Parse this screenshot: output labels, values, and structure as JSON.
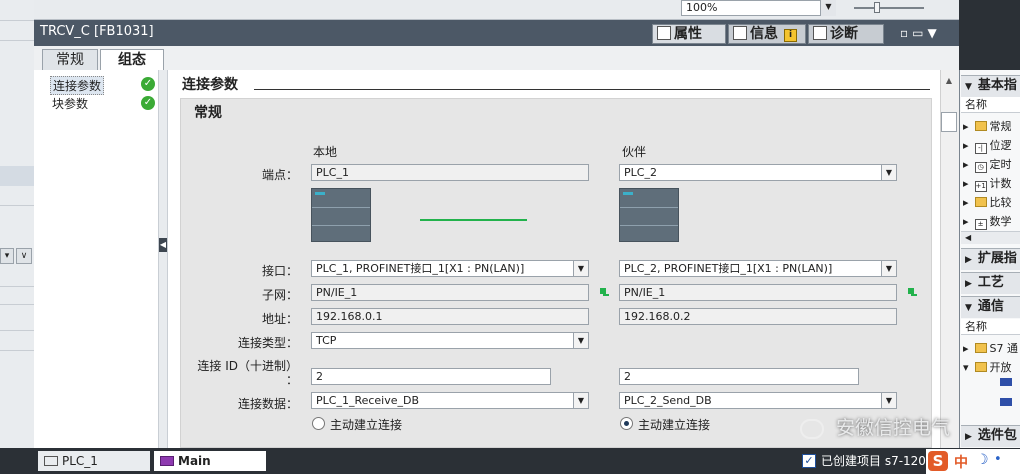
{
  "toolbar": {
    "zoom": "100%"
  },
  "window": {
    "title": "TRCV_C [FB1031]"
  },
  "inspector_tabs": [
    {
      "label": "属性",
      "icon": "properties-icon"
    },
    {
      "label": "信息",
      "icon": "info-icon",
      "badge": "i"
    },
    {
      "label": "诊断",
      "icon": "diagnostics-icon"
    }
  ],
  "editor_tabs": [
    {
      "label": "常规"
    },
    {
      "label": "组态"
    }
  ],
  "sidebar": {
    "items": [
      {
        "label": "连接参数"
      },
      {
        "label": "块参数"
      }
    ]
  },
  "section": {
    "title": "连接参数",
    "group_title": "常规"
  },
  "form": {
    "col_local": "本地",
    "col_partner": "伙伴",
    "labels": {
      "endpoint": "端点：",
      "interface": "接口：",
      "subnet": "子网：",
      "address": "地址：",
      "conn_type": "连接类型：",
      "conn_id_1": "连接 ID（十进制）",
      "conn_id_2": "：",
      "conn_data": "连接数据："
    },
    "local": {
      "endpoint": "PLC_1",
      "interface": "PLC_1, PROFINET接口_1[X1 : PN(LAN)]",
      "subnet": "PN/IE_1",
      "address": "192.168.0.1",
      "conn_type": "TCP",
      "conn_id": "2",
      "conn_data": "PLC_1_Receive_DB",
      "active_label": "主动建立连接",
      "active": false
    },
    "partner": {
      "endpoint": "PLC_2",
      "interface": "PLC_2, PROFINET接口_1[X1 : PN(LAN)]",
      "subnet": "PN/IE_1",
      "address": "192.168.0.2",
      "conn_id": "2",
      "conn_data": "PLC_2_Send_DB",
      "active_label": "主动建立连接",
      "active": true
    }
  },
  "right_panel": {
    "basic_header": "基本指",
    "col_name": "名称",
    "basic_items": [
      "常规",
      "位逻",
      "定时",
      "计数",
      "比较",
      "数学"
    ],
    "ext_header": "扩展指",
    "tech_header": "工艺",
    "comm_header": "通信",
    "col_name2": "名称",
    "comm_items": [
      "S7 通",
      "开放"
    ],
    "options_header": "选件包"
  },
  "watermark": "安徽信控电气",
  "taskbar": {
    "items": [
      {
        "label": "PLC_1"
      },
      {
        "label": "Main"
      }
    ],
    "status": "已创建项目 s7-120",
    "ime": {
      "brand": "S",
      "lang": "中",
      "moon": "☽",
      "dot": "•"
    }
  },
  "colors": {
    "accent_green": "#22b24c",
    "title_bar": "#4c5866",
    "check_green": "#3aaa35"
  }
}
